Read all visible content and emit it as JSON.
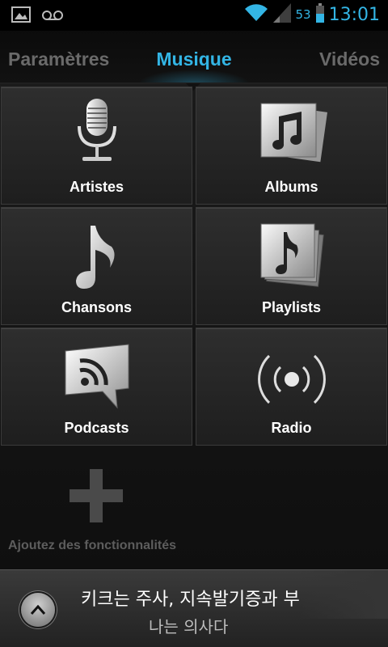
{
  "status_bar": {
    "left_icons": [
      "image-notification-icon",
      "voicemail-icon"
    ],
    "battery_percent": "53",
    "time": "13:01"
  },
  "tabs": {
    "left": "Paramètres",
    "center": "Musique",
    "right": "Vidéos"
  },
  "grid": {
    "items": [
      {
        "label": "Artistes",
        "icon": "microphone-icon"
      },
      {
        "label": "Albums",
        "icon": "albums-icon"
      },
      {
        "label": "Chansons",
        "icon": "music-note-icon"
      },
      {
        "label": "Playlists",
        "icon": "playlists-icon"
      },
      {
        "label": "Podcasts",
        "icon": "podcast-icon"
      },
      {
        "label": "Radio",
        "icon": "radio-icon"
      }
    ],
    "add_label": "Ajoutez des fonctionnalités"
  },
  "now_playing": {
    "title": "키크는 주사, 지속발기증과 부",
    "artist": "나는 의사다"
  },
  "colors": {
    "accent": "#33b5e5"
  }
}
